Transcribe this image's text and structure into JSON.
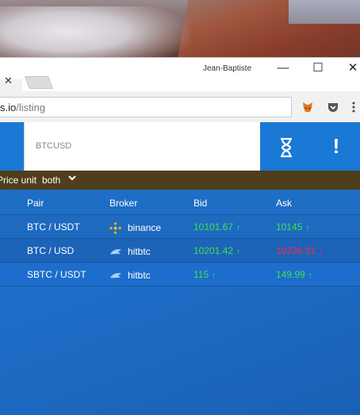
{
  "window": {
    "user": "Jean-Baptiste",
    "minimize": "—",
    "maximize": "☐",
    "close": "✕"
  },
  "browser": {
    "tab_close": "✕",
    "url_domain": "s.io",
    "url_path": "/listing",
    "extensions": [
      "metamask-fox-icon",
      "pocket-icon",
      "menu-icon"
    ]
  },
  "app": {
    "search": {
      "value": "BTCUSD"
    },
    "hourglass_icon": "⧗",
    "alert_icon": "!",
    "price_unit": {
      "label": "Price unit",
      "value": "both"
    },
    "table": {
      "headers": {
        "pair": "Pair",
        "broker": "Broker",
        "bid": "Bid",
        "ask": "Ask"
      },
      "rows": [
        {
          "pair": "BTC / USDT",
          "broker": "binance",
          "broker_icon": "binance-icon",
          "bid": "10101.67",
          "bid_dir": "up",
          "ask": "10145",
          "ask_dir": "up"
        },
        {
          "pair": "BTC / USD",
          "broker": "hitbtc",
          "broker_icon": "hitbtc-icon",
          "bid": "10201.42",
          "bid_dir": "up",
          "ask": "10226.31",
          "ask_dir": "down"
        },
        {
          "pair": "SBTC / USDT",
          "broker": "hitbtc",
          "broker_icon": "hitbtc-icon",
          "bid": "115",
          "bid_dir": "up",
          "ask": "149.99",
          "ask_dir": "up"
        }
      ]
    }
  }
}
